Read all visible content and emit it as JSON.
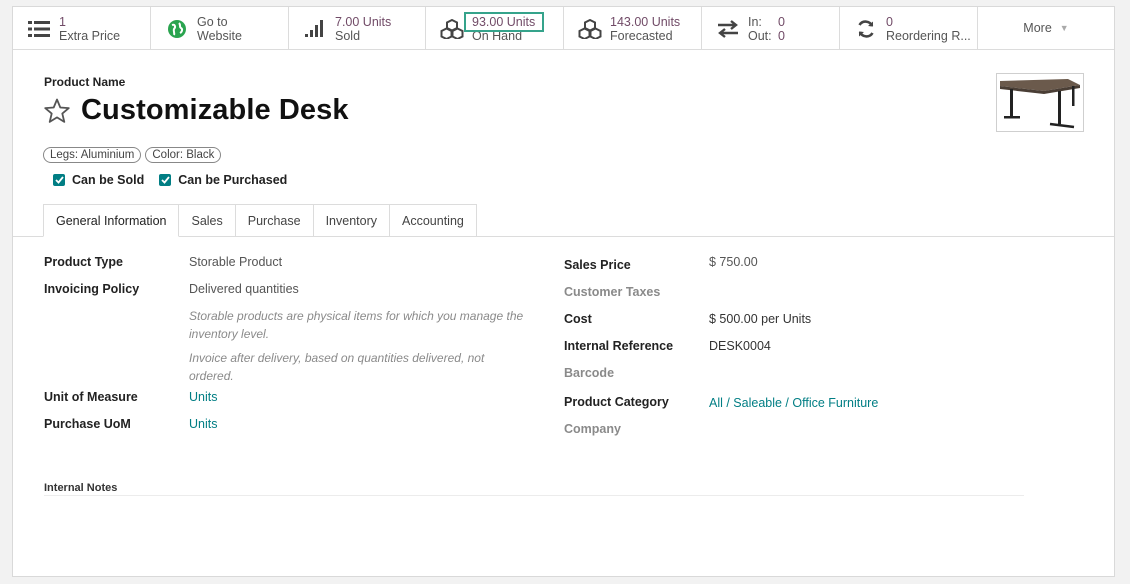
{
  "smart_buttons": {
    "extra_price": {
      "value": "1",
      "label": "Extra Price"
    },
    "website": {
      "line1": "Go to",
      "line2": "Website"
    },
    "sold": {
      "value": "7.00 Units",
      "label": "Sold"
    },
    "on_hand": {
      "value": "93.00 Units",
      "label": "On Hand"
    },
    "forecasted": {
      "value": "143.00 Units",
      "label": "Forecasted"
    },
    "in_out": {
      "in_label": "In:",
      "in_value": "0",
      "out_label": "Out:",
      "out_value": "0"
    },
    "reordering": {
      "value": "0",
      "label": "Reordering R..."
    },
    "more": "More"
  },
  "product": {
    "name_label": "Product Name",
    "name": "Customizable Desk",
    "tags": [
      "Legs: Aluminium",
      "Color: Black"
    ],
    "can_be_sold": "Can be Sold",
    "can_be_purchased": "Can be Purchased"
  },
  "tabs": [
    "General Information",
    "Sales",
    "Purchase",
    "Inventory",
    "Accounting"
  ],
  "general": {
    "left": {
      "product_type_label": "Product Type",
      "product_type": "Storable Product",
      "invoicing_policy_label": "Invoicing Policy",
      "invoicing_policy": "Delivered quantities",
      "help1": "Storable products are physical items for which you manage the inventory level.",
      "help2": "Invoice after delivery, based on quantities delivered, not ordered.",
      "uom_label": "Unit of Measure",
      "uom": "Units",
      "purchase_uom_label": "Purchase UoM",
      "purchase_uom": "Units"
    },
    "right": {
      "sales_price_label": "Sales Price",
      "sales_price": "$ 750.00",
      "customer_taxes_label": "Customer Taxes",
      "cost_label": "Cost",
      "cost": "$ 500.00",
      "cost_unit": "per Units",
      "internal_ref_label": "Internal Reference",
      "internal_ref": "DESK0004",
      "barcode_label": "Barcode",
      "category_label": "Product Category",
      "category": "All / Saleable / Office Furniture",
      "company_label": "Company"
    },
    "internal_notes_label": "Internal Notes"
  },
  "colors": {
    "accent": "#714B67",
    "link": "#017e84",
    "highlight": "#35a38b"
  }
}
